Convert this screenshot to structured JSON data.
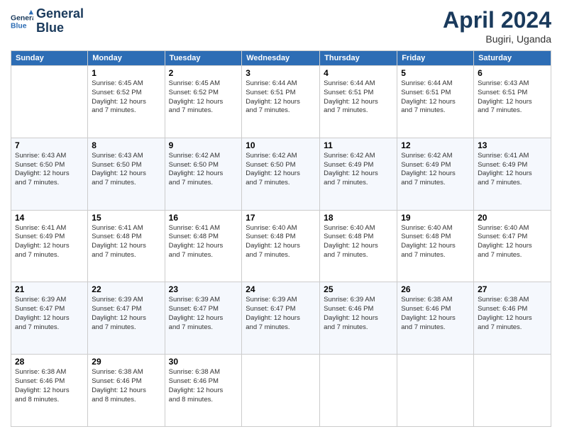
{
  "logo": {
    "line1": "General",
    "line2": "Blue"
  },
  "title": "April 2024",
  "subtitle": "Bugiri, Uganda",
  "days_of_week": [
    "Sunday",
    "Monday",
    "Tuesday",
    "Wednesday",
    "Thursday",
    "Friday",
    "Saturday"
  ],
  "weeks": [
    [
      {
        "day": "",
        "info": ""
      },
      {
        "day": "1",
        "info": "Sunrise: 6:45 AM\nSunset: 6:52 PM\nDaylight: 12 hours\nand 7 minutes."
      },
      {
        "day": "2",
        "info": "Sunrise: 6:45 AM\nSunset: 6:52 PM\nDaylight: 12 hours\nand 7 minutes."
      },
      {
        "day": "3",
        "info": "Sunrise: 6:44 AM\nSunset: 6:51 PM\nDaylight: 12 hours\nand 7 minutes."
      },
      {
        "day": "4",
        "info": "Sunrise: 6:44 AM\nSunset: 6:51 PM\nDaylight: 12 hours\nand 7 minutes."
      },
      {
        "day": "5",
        "info": "Sunrise: 6:44 AM\nSunset: 6:51 PM\nDaylight: 12 hours\nand 7 minutes."
      },
      {
        "day": "6",
        "info": "Sunrise: 6:43 AM\nSunset: 6:51 PM\nDaylight: 12 hours\nand 7 minutes."
      }
    ],
    [
      {
        "day": "7",
        "info": "Sunrise: 6:43 AM\nSunset: 6:50 PM\nDaylight: 12 hours\nand 7 minutes."
      },
      {
        "day": "8",
        "info": "Sunrise: 6:43 AM\nSunset: 6:50 PM\nDaylight: 12 hours\nand 7 minutes."
      },
      {
        "day": "9",
        "info": "Sunrise: 6:42 AM\nSunset: 6:50 PM\nDaylight: 12 hours\nand 7 minutes."
      },
      {
        "day": "10",
        "info": "Sunrise: 6:42 AM\nSunset: 6:50 PM\nDaylight: 12 hours\nand 7 minutes."
      },
      {
        "day": "11",
        "info": "Sunrise: 6:42 AM\nSunset: 6:49 PM\nDaylight: 12 hours\nand 7 minutes."
      },
      {
        "day": "12",
        "info": "Sunrise: 6:42 AM\nSunset: 6:49 PM\nDaylight: 12 hours\nand 7 minutes."
      },
      {
        "day": "13",
        "info": "Sunrise: 6:41 AM\nSunset: 6:49 PM\nDaylight: 12 hours\nand 7 minutes."
      }
    ],
    [
      {
        "day": "14",
        "info": "Sunrise: 6:41 AM\nSunset: 6:49 PM\nDaylight: 12 hours\nand 7 minutes."
      },
      {
        "day": "15",
        "info": "Sunrise: 6:41 AM\nSunset: 6:48 PM\nDaylight: 12 hours\nand 7 minutes."
      },
      {
        "day": "16",
        "info": "Sunrise: 6:41 AM\nSunset: 6:48 PM\nDaylight: 12 hours\nand 7 minutes."
      },
      {
        "day": "17",
        "info": "Sunrise: 6:40 AM\nSunset: 6:48 PM\nDaylight: 12 hours\nand 7 minutes."
      },
      {
        "day": "18",
        "info": "Sunrise: 6:40 AM\nSunset: 6:48 PM\nDaylight: 12 hours\nand 7 minutes."
      },
      {
        "day": "19",
        "info": "Sunrise: 6:40 AM\nSunset: 6:48 PM\nDaylight: 12 hours\nand 7 minutes."
      },
      {
        "day": "20",
        "info": "Sunrise: 6:40 AM\nSunset: 6:47 PM\nDaylight: 12 hours\nand 7 minutes."
      }
    ],
    [
      {
        "day": "21",
        "info": "Sunrise: 6:39 AM\nSunset: 6:47 PM\nDaylight: 12 hours\nand 7 minutes."
      },
      {
        "day": "22",
        "info": "Sunrise: 6:39 AM\nSunset: 6:47 PM\nDaylight: 12 hours\nand 7 minutes."
      },
      {
        "day": "23",
        "info": "Sunrise: 6:39 AM\nSunset: 6:47 PM\nDaylight: 12 hours\nand 7 minutes."
      },
      {
        "day": "24",
        "info": "Sunrise: 6:39 AM\nSunset: 6:47 PM\nDaylight: 12 hours\nand 7 minutes."
      },
      {
        "day": "25",
        "info": "Sunrise: 6:39 AM\nSunset: 6:46 PM\nDaylight: 12 hours\nand 7 minutes."
      },
      {
        "day": "26",
        "info": "Sunrise: 6:38 AM\nSunset: 6:46 PM\nDaylight: 12 hours\nand 7 minutes."
      },
      {
        "day": "27",
        "info": "Sunrise: 6:38 AM\nSunset: 6:46 PM\nDaylight: 12 hours\nand 7 minutes."
      }
    ],
    [
      {
        "day": "28",
        "info": "Sunrise: 6:38 AM\nSunset: 6:46 PM\nDaylight: 12 hours\nand 8 minutes."
      },
      {
        "day": "29",
        "info": "Sunrise: 6:38 AM\nSunset: 6:46 PM\nDaylight: 12 hours\nand 8 minutes."
      },
      {
        "day": "30",
        "info": "Sunrise: 6:38 AM\nSunset: 6:46 PM\nDaylight: 12 hours\nand 8 minutes."
      },
      {
        "day": "",
        "info": ""
      },
      {
        "day": "",
        "info": ""
      },
      {
        "day": "",
        "info": ""
      },
      {
        "day": "",
        "info": ""
      }
    ]
  ]
}
